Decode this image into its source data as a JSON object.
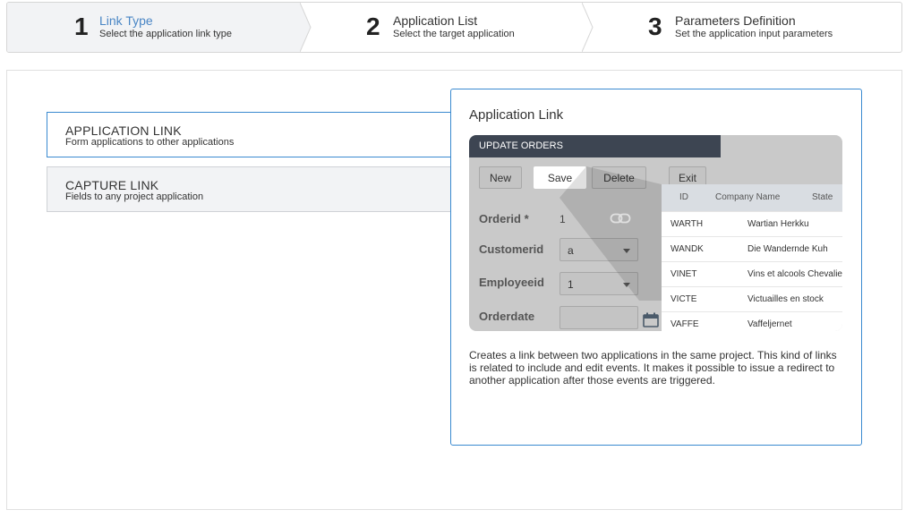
{
  "steps": [
    {
      "number": "1",
      "title": "Link Type",
      "subtitle": "Select the application link type"
    },
    {
      "number": "2",
      "title": "Application List",
      "subtitle": "Select the target application"
    },
    {
      "number": "3",
      "title": "Parameters Definition",
      "subtitle": "Set the application input parameters"
    }
  ],
  "options": [
    {
      "title": "APPLICATION LINK",
      "subtitle": "Form applications to other applications"
    },
    {
      "title": "CAPTURE LINK",
      "subtitle": "Fields to any project application"
    }
  ],
  "detail": {
    "title": "Application Link",
    "description": "Creates a link between two applications in the same project. This kind of links is related to include and edit events. It makes it possible to issue a redirect to another application after those events are triggered."
  },
  "preview": {
    "header": "UPDATE ORDERS",
    "buttons": {
      "new": "New",
      "save": "Save",
      "delete": "Delete",
      "exit": "Exit"
    },
    "fields": {
      "orderid_label": "Orderid *",
      "orderid_value": "1",
      "customerid_label": "Customerid",
      "customerid_value": "a",
      "employeeid_label": "Employeeid",
      "employeeid_value": "1",
      "orderdate_label": "Orderdate"
    },
    "table": {
      "columns": [
        "ID",
        "Company Name",
        "State"
      ],
      "rows": [
        {
          "id": "WARTH",
          "name": "Wartian Herkku"
        },
        {
          "id": "WANDK",
          "name": "Die Wandernde Kuh"
        },
        {
          "id": "VINET",
          "name": "Vins et alcools Chevalier"
        },
        {
          "id": "VICTE",
          "name": "Victuailles en stock"
        },
        {
          "id": "VAFFE",
          "name": "Vaffeljernet"
        }
      ]
    }
  },
  "colors": {
    "accent": "#3a8ad0",
    "active_step": "#4a86c5",
    "header_dark": "#3d4552"
  }
}
